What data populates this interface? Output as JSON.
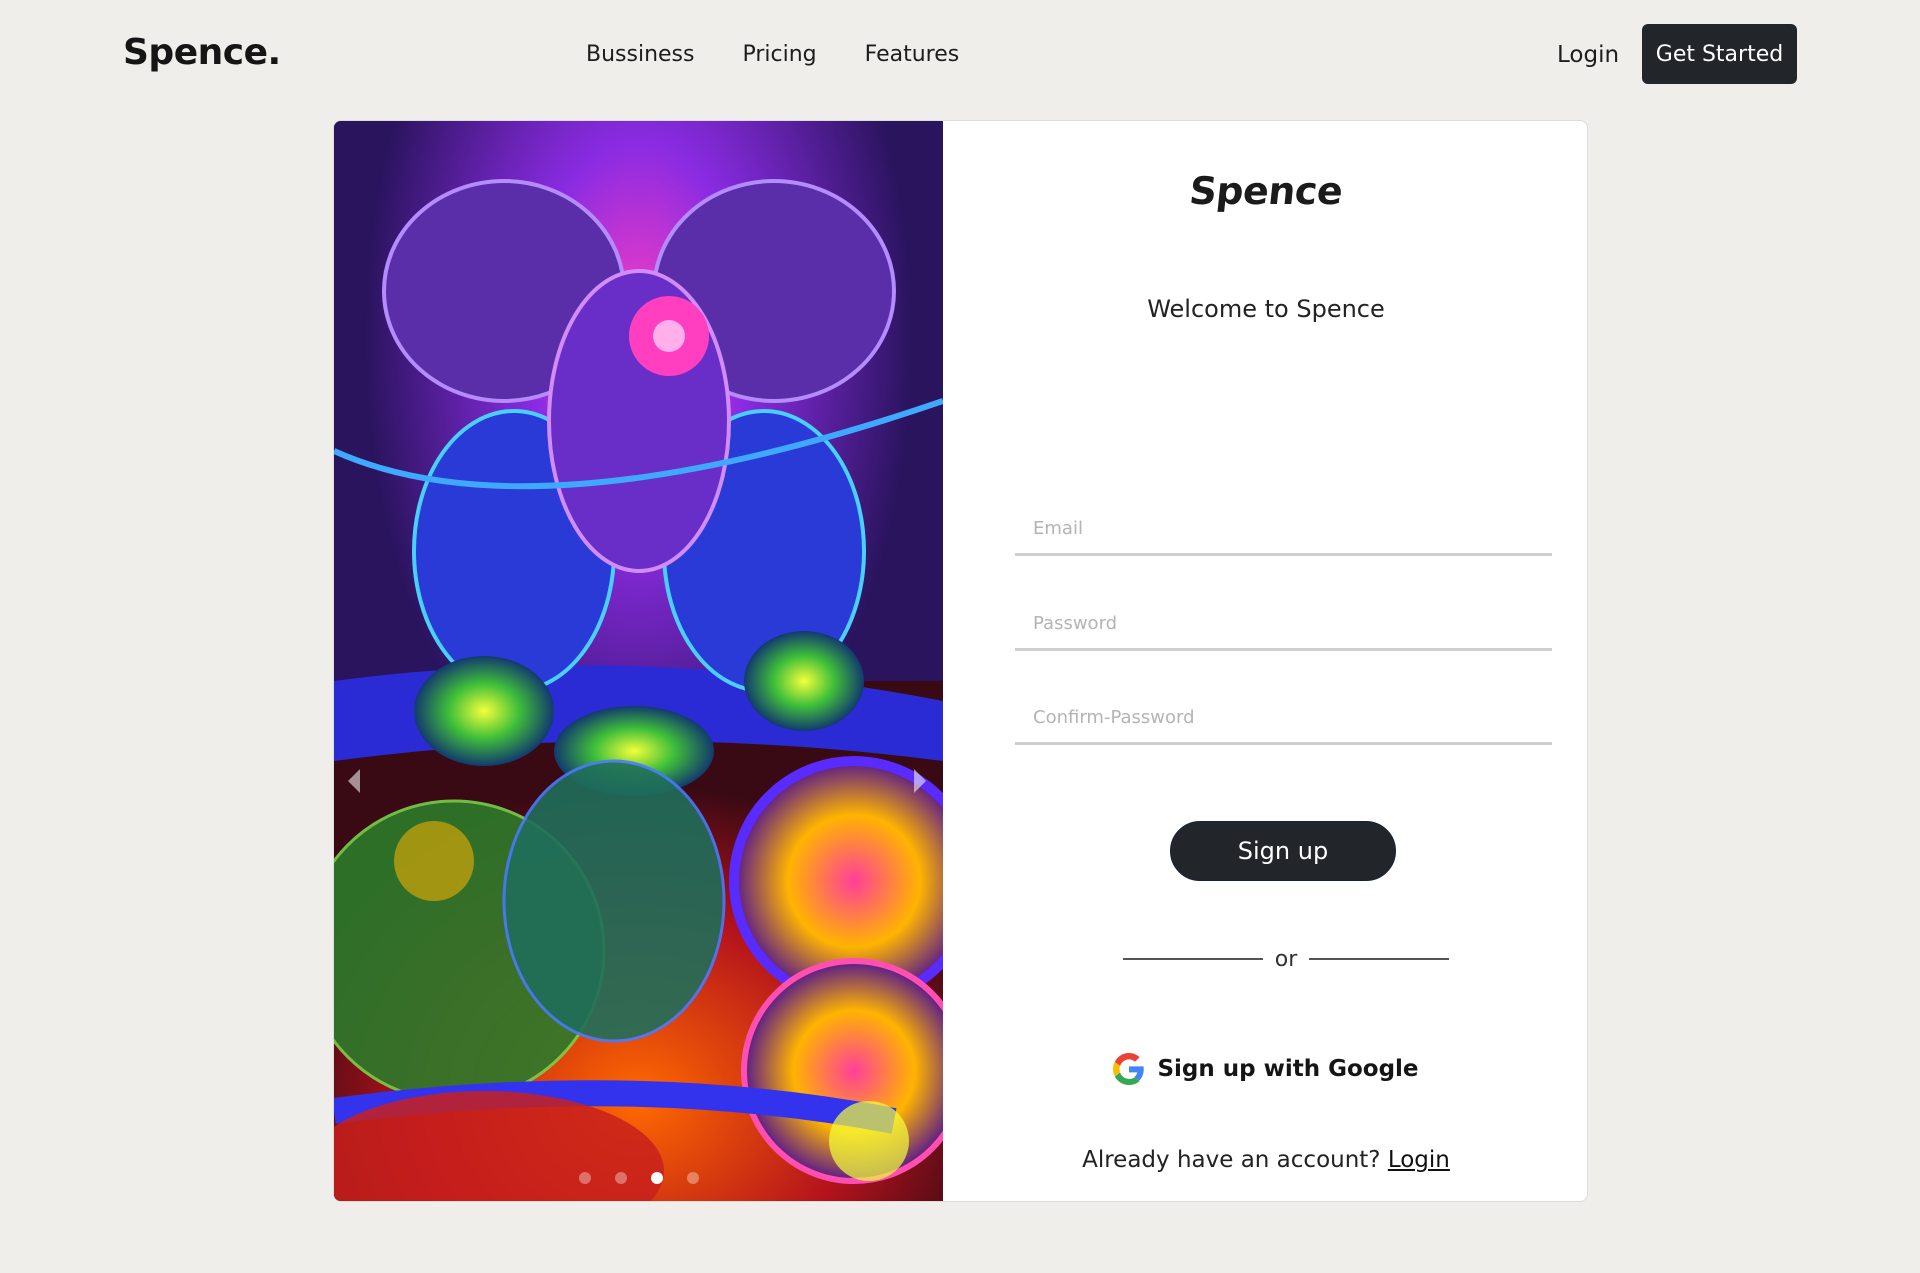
{
  "navbar": {
    "brand": "Spence.",
    "links": [
      "Bussiness",
      "Pricing",
      "Features"
    ],
    "login": "Login",
    "cta": "Get Started"
  },
  "carousel": {
    "slide_count": 4,
    "active_index": 2
  },
  "form": {
    "logo": "Spence",
    "welcome": "Welcome to Spence",
    "email_placeholder": "Email",
    "password_placeholder": "Password",
    "confirm_placeholder": "Confirm-Password",
    "signup_button": "Sign up",
    "divider_text": "or",
    "google_label": "Sign up with Google",
    "already_text": "Already have an account?",
    "login_link": "Login"
  },
  "colors": {
    "background": "#efeeeb",
    "button_dark": "#22252a",
    "field_underline": "#cfcfcf"
  }
}
